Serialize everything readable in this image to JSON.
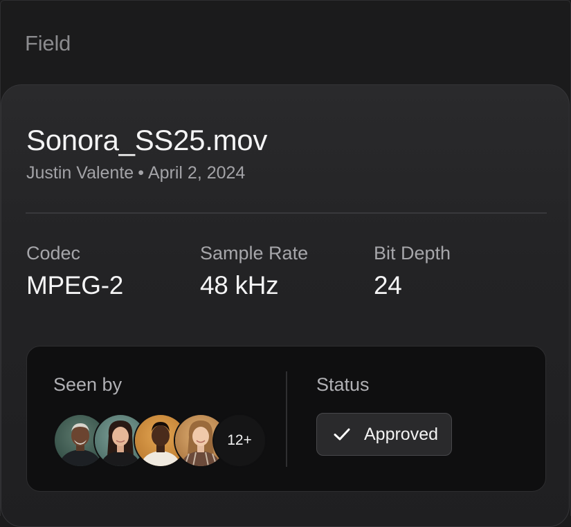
{
  "section": {
    "label": "Field"
  },
  "file": {
    "name": "Sonora_SS25.mov",
    "author": "Justin Valente",
    "separator": "•",
    "date": "April 2, 2024"
  },
  "specs": [
    {
      "label": "Codec",
      "value": "MPEG-2"
    },
    {
      "label": "Sample Rate",
      "value": "48 kHz"
    },
    {
      "label": "Bit Depth",
      "value": "24"
    }
  ],
  "seen_by": {
    "label": "Seen by",
    "more_count": "12+",
    "avatars": [
      "avatar-person-1",
      "avatar-person-2",
      "avatar-person-3",
      "avatar-person-4"
    ]
  },
  "status": {
    "label": "Status",
    "value": "Approved",
    "icon": "check-icon"
  },
  "colors": {
    "background": "#1b1b1c",
    "card": "#242426",
    "panel": "#0f0f10",
    "text_primary": "#f4f4f5",
    "text_secondary": "#a6a6aa"
  }
}
